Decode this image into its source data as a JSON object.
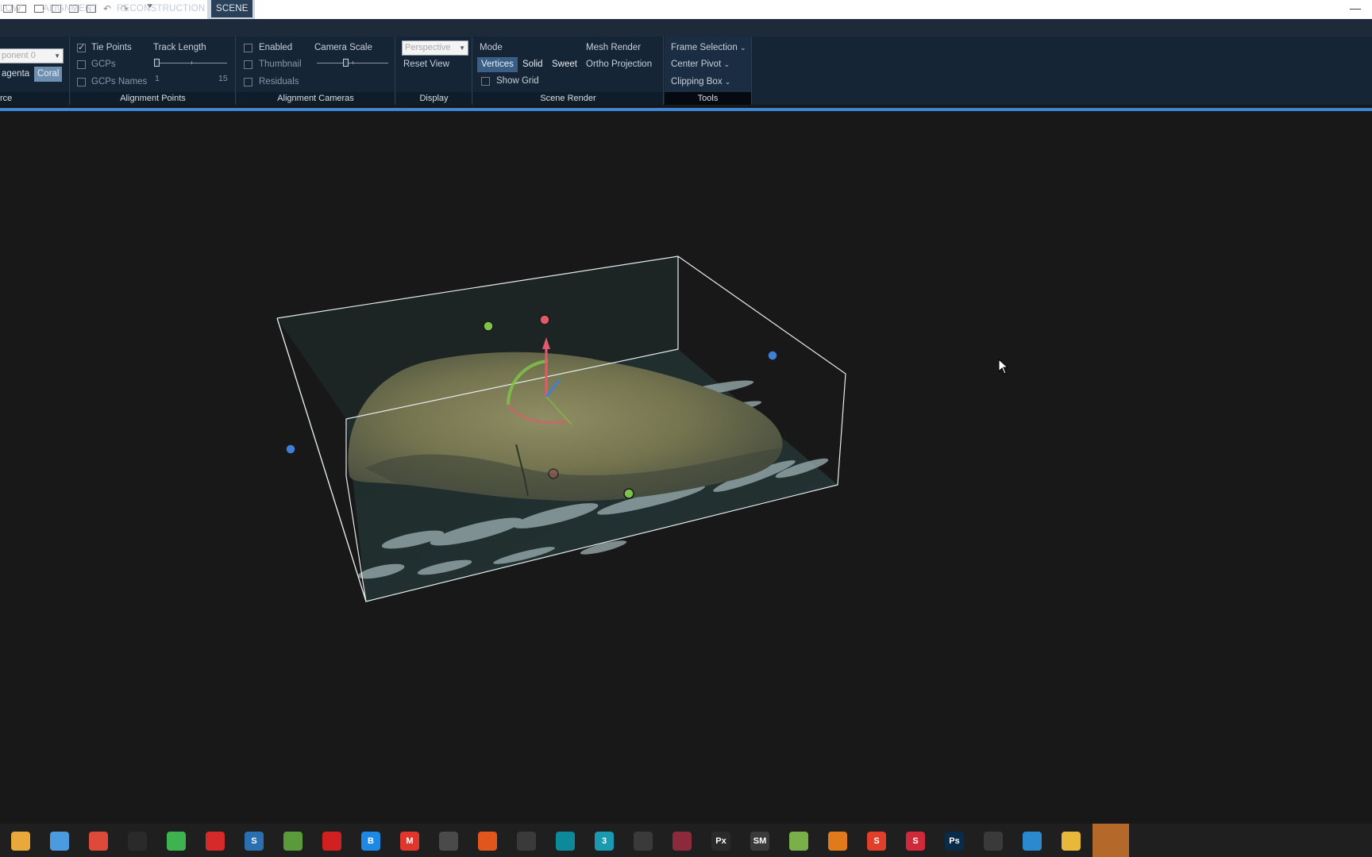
{
  "titlebar": {
    "tab3d_label": "3D",
    "minimize_label": "—",
    "quick_access": [
      "layout-icon",
      "layout-icon",
      "layout-icon",
      "layout-icon",
      "layout-icon",
      "layout-icon",
      "undo-icon",
      "redo-icon"
    ]
  },
  "tabs": [
    {
      "label": "LOW",
      "active": false
    },
    {
      "label": "ALIGNMENT",
      "active": false
    },
    {
      "label": "RECONSTRUCTION",
      "active": false
    },
    {
      "label": "SCENE",
      "active": true
    }
  ],
  "ribbon": {
    "source": {
      "component_value": "ponent 0",
      "color_magenta": "agenta",
      "color_coral": "Coral",
      "footer": "rce"
    },
    "alignment_points": {
      "footer": "Alignment Points",
      "tie_points": {
        "label": "Tie Points",
        "checked": true
      },
      "gcps": {
        "label": "GCPs",
        "checked": false
      },
      "gcps_names": {
        "label": "GCPs Names",
        "checked": false
      },
      "track_length_label": "Track Length",
      "track_min": "1",
      "track_max": "15",
      "track_value": 1
    },
    "alignment_cameras": {
      "footer": "Alignment Cameras",
      "enabled": {
        "label": "Enabled",
        "checked": false
      },
      "thumbnail": {
        "label": "Thumbnail",
        "checked": false
      },
      "residuals": {
        "label": "Residuals",
        "checked": false
      },
      "camera_scale_label": "Camera Scale"
    },
    "display": {
      "footer": "Display",
      "projection_value": "Perspective",
      "reset_view": "Reset View"
    },
    "scene_render": {
      "footer": "Scene Render",
      "mode_label": "Mode",
      "mode_vertices": "Vertices",
      "mode_solid": "Solid",
      "mode_sweet": "Sweet",
      "mesh_render_label": "Mesh Render",
      "ortho_projection": "Ortho Projection",
      "show_grid": {
        "label": "Show Grid",
        "checked": false
      }
    },
    "tools": {
      "footer": "Tools",
      "frame_selection": "Frame Selection",
      "center_pivot": "Center Pivot",
      "clipping_box": "Clipping Box"
    }
  },
  "colors": {
    "accent": "#3b86d6",
    "ribbon_bg": "#152536",
    "selected": "#3a5f86",
    "gizmo_red": "#e05a6a",
    "gizmo_green": "#7fc24a",
    "gizmo_blue": "#3f7fd8"
  },
  "taskbar": {
    "apps": [
      {
        "name": "paint-palette-icon",
        "label": "",
        "color": "#e8a93a"
      },
      {
        "name": "pinwheel-icon",
        "label": "",
        "color": "#4a9be0"
      },
      {
        "name": "chrome-icon",
        "label": "",
        "color": "#dd4a3a"
      },
      {
        "name": "penguin-icon",
        "label": "",
        "color": "#2a2a2a"
      },
      {
        "name": "wechat-icon",
        "label": "",
        "color": "#3fb34f"
      },
      {
        "name": "netease-music-icon",
        "label": "",
        "color": "#d62a2a"
      },
      {
        "name": "s-app-icon",
        "label": "S",
        "color": "#2a6fb0"
      },
      {
        "name": "globe-app-icon",
        "label": "",
        "color": "#5a9a3a"
      },
      {
        "name": "record-icon",
        "label": "",
        "color": "#d12020"
      },
      {
        "name": "b-app-icon",
        "label": "B",
        "color": "#1e88e5"
      },
      {
        "name": "m-app-icon",
        "label": "M",
        "color": "#e0362c"
      },
      {
        "name": "aperture-icon",
        "label": "",
        "color": "#4a4a4a"
      },
      {
        "name": "flame-app-icon",
        "label": "",
        "color": "#e0561c"
      },
      {
        "name": "search-app-icon",
        "label": "",
        "color": "#3a3a3a"
      },
      {
        "name": "maps-app-icon",
        "label": "",
        "color": "#0c8a9a"
      },
      {
        "name": "3dsmax-icon",
        "label": "3",
        "color": "#1a9ab0"
      },
      {
        "name": "zbrush-icon",
        "label": "",
        "color": "#3a3a3a"
      },
      {
        "name": "heart-app-icon",
        "label": "",
        "color": "#8a2a3a"
      },
      {
        "name": "px-app-icon",
        "label": "Px",
        "color": "#2a2a2a"
      },
      {
        "name": "sm-app-icon",
        "label": "SM",
        "color": "#3a3a3a"
      },
      {
        "name": "tree-app-icon",
        "label": "",
        "color": "#7ab04a"
      },
      {
        "name": "blender-icon",
        "label": "",
        "color": "#e07a1a"
      },
      {
        "name": "substance-designer-icon",
        "label": "S",
        "color": "#e0402a"
      },
      {
        "name": "substance-painter-icon",
        "label": "S",
        "color": "#d02a3a"
      },
      {
        "name": "photoshop-icon",
        "label": "Ps",
        "color": "#0a2a4a"
      },
      {
        "name": "unity-icon",
        "label": "",
        "color": "#3a3a3a"
      },
      {
        "name": "edge-icon",
        "label": "",
        "color": "#2a8ad0"
      },
      {
        "name": "file-explorer-icon",
        "label": "",
        "color": "#e8b83a"
      },
      {
        "name": "realitycapture-icon",
        "label": "",
        "color": "#b4682a"
      }
    ]
  }
}
